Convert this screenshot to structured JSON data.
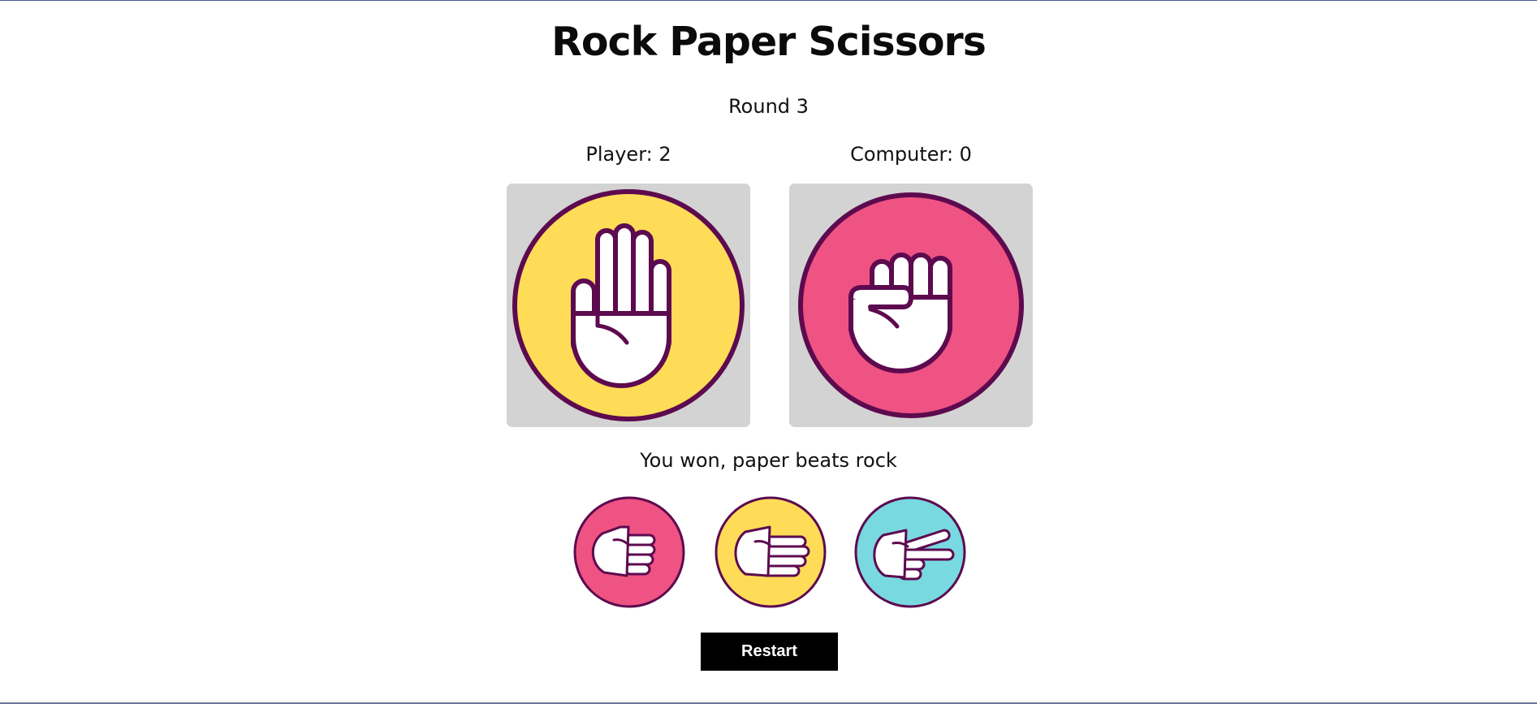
{
  "title": "Rock Paper Scissors",
  "round_text": "Round 3",
  "scores": {
    "player_text": "Player: 2",
    "computer_text": "Computer: 0"
  },
  "picks": {
    "player": "paper",
    "computer": "rock"
  },
  "result_text": "You won, paper beats rock",
  "choices": [
    {
      "name": "rock",
      "icon": "rock-hand-icon",
      "color": "#ef5383"
    },
    {
      "name": "paper",
      "icon": "paper-hand-icon",
      "color": "#fedc58"
    },
    {
      "name": "scissors",
      "icon": "scissors-hand-icon",
      "color": "#79d9e1"
    }
  ],
  "colors": {
    "outline": "#5d0a4f",
    "rock": "#ef5383",
    "paper": "#fedc58",
    "scissors": "#79d9e1",
    "panel": "#d3d3d3",
    "restart_bg": "#000000"
  },
  "restart_label": "Restart"
}
